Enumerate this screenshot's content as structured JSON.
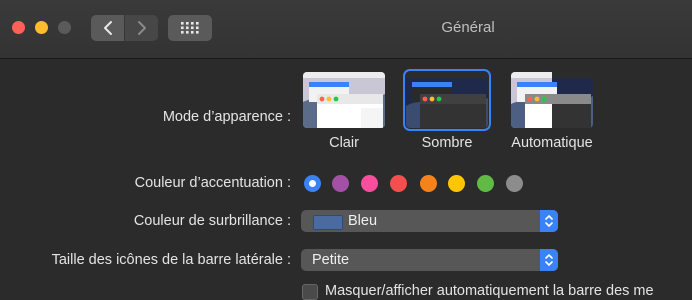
{
  "window": {
    "title": "Général"
  },
  "colors": {
    "accent": "#3a82f7",
    "swatches": [
      "#3a82f7",
      "#a550a7",
      "#f74f9e",
      "#f54e4e",
      "#f7821b",
      "#ffc600",
      "#62ba46",
      "#8c8c8c"
    ]
  },
  "appearance": {
    "label": "Mode d’apparence :",
    "options": [
      {
        "label": "Clair"
      },
      {
        "label": "Sombre"
      },
      {
        "label": "Automatique"
      }
    ],
    "selected": "Sombre"
  },
  "accent": {
    "label": "Couleur d’accentuation :",
    "selected_index": 0
  },
  "highlight": {
    "label": "Couleur de surbrillance :",
    "value": "Bleu",
    "swatch_color": "#4a6aa0"
  },
  "sidebar_size": {
    "label": "Taille des icônes de la barre latérale :",
    "value": "Petite"
  },
  "menubar": {
    "label": "Masquer/afficher automatiquement la barre des me"
  }
}
